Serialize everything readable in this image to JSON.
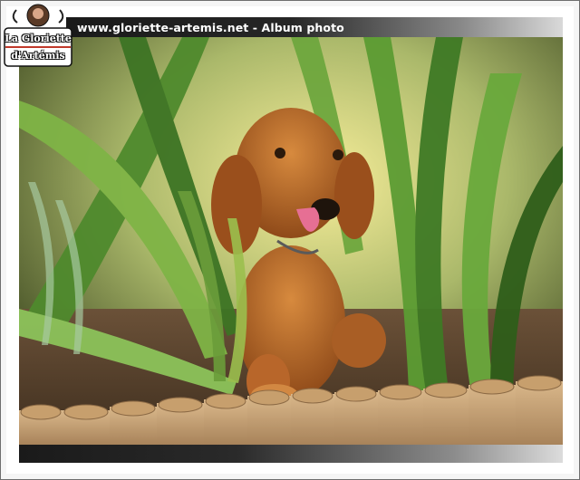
{
  "header": {
    "title": "www.gloriette-artemis.net - Album photo"
  },
  "logo": {
    "line1": "La Gloriette",
    "line2": "d'Artémis"
  },
  "photo": {
    "subject": "puppy-among-plants"
  },
  "colors": {
    "titlebar_dark": "#1a1a1a",
    "titlebar_light": "#d9d9d9",
    "border": "#6e6e6e",
    "logo_accent": "#c0392b"
  }
}
